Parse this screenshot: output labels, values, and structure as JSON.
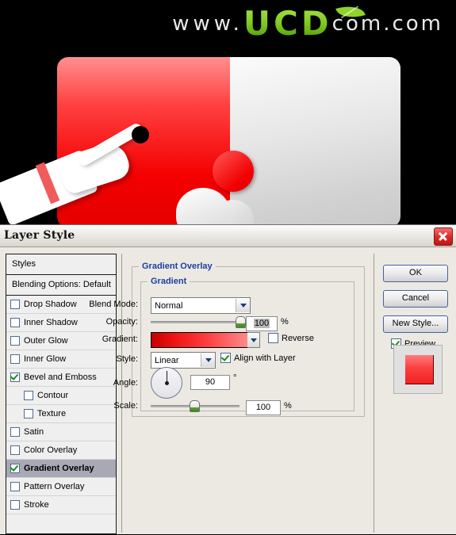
{
  "banner": {
    "logo_www": "www.",
    "logo_mark": "UCD",
    "logo_tail": "com.com",
    "leaf_icon": "leaf-icon"
  },
  "dialog": {
    "title": "Layer Style",
    "close_icon": "close-icon"
  },
  "sidebar": {
    "header": "Styles",
    "blending_options": "Blending Options: Default",
    "items": [
      {
        "label": "Drop Shadow",
        "checked": false,
        "sub": false,
        "selected": false
      },
      {
        "label": "Inner Shadow",
        "checked": false,
        "sub": false,
        "selected": false
      },
      {
        "label": "Outer Glow",
        "checked": false,
        "sub": false,
        "selected": false
      },
      {
        "label": "Inner Glow",
        "checked": false,
        "sub": false,
        "selected": false
      },
      {
        "label": "Bevel and Emboss",
        "checked": true,
        "sub": false,
        "selected": false
      },
      {
        "label": "Contour",
        "checked": false,
        "sub": true,
        "selected": false
      },
      {
        "label": "Texture",
        "checked": false,
        "sub": true,
        "selected": false
      },
      {
        "label": "Satin",
        "checked": false,
        "sub": false,
        "selected": false
      },
      {
        "label": "Color Overlay",
        "checked": false,
        "sub": false,
        "selected": false
      },
      {
        "label": "Gradient Overlay",
        "checked": true,
        "sub": false,
        "selected": true
      },
      {
        "label": "Pattern Overlay",
        "checked": false,
        "sub": false,
        "selected": false
      },
      {
        "label": "Stroke",
        "checked": false,
        "sub": false,
        "selected": false
      }
    ]
  },
  "panel": {
    "section_title": "Gradient Overlay",
    "group_title": "Gradient",
    "blend_mode": {
      "label": "Blend Mode:",
      "value": "Normal"
    },
    "opacity": {
      "label": "Opacity:",
      "value": "100",
      "unit": "%",
      "slider_pct": 100
    },
    "gradient": {
      "label": "Gradient:",
      "stop_start": "#c40000",
      "stop_end": "#fd8a8a",
      "reverse_label": "Reverse",
      "reverse_checked": false
    },
    "style": {
      "label": "Style:",
      "value": "Linear",
      "align_label": "Align with Layer",
      "align_checked": true
    },
    "angle": {
      "label": "Angle:",
      "value": "90",
      "unit": "°"
    },
    "scale": {
      "label": "Scale:",
      "value": "100",
      "unit": "%",
      "slider_pct": 48
    }
  },
  "actions": {
    "ok": "OK",
    "cancel": "Cancel",
    "new_style": "New Style...",
    "preview_label": "Preview",
    "preview_checked": true
  }
}
